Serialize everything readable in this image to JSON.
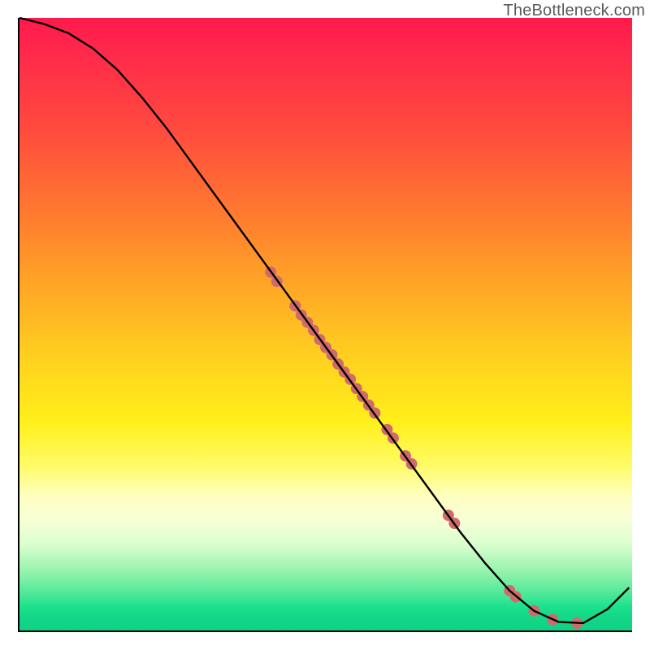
{
  "watermark": "TheBottleneck.com",
  "chart_data": {
    "type": "line",
    "title": "",
    "xlabel": "",
    "ylabel": "",
    "xlim": [
      0,
      100
    ],
    "ylim": [
      0,
      100
    ],
    "grid": false,
    "legend": false,
    "series": [
      {
        "name": "bottleneck-curve",
        "x": [
          0,
          4,
          8,
          12,
          16,
          20,
          24,
          28,
          32,
          36,
          40,
          44,
          48,
          52,
          56,
          60,
          64,
          68,
          72,
          76,
          80,
          84,
          88,
          92,
          96,
          99.5
        ],
        "y": [
          100,
          99,
          97.5,
          95,
          91.5,
          87,
          82,
          76.5,
          71,
          65.5,
          60,
          54.5,
          49,
          43.5,
          38,
          32.5,
          27,
          21.5,
          16,
          11,
          6.5,
          3.2,
          1.4,
          1.2,
          3.5,
          7
        ],
        "color": "#000000",
        "width": 2.4
      }
    ],
    "scatter_points": {
      "name": "highlighted-points",
      "color": "#d16a6a",
      "radius": 7,
      "points": [
        {
          "x": 41,
          "y": 58.5
        },
        {
          "x": 42,
          "y": 57
        },
        {
          "x": 45,
          "y": 53
        },
        {
          "x": 46,
          "y": 51.5
        },
        {
          "x": 47,
          "y": 50.3
        },
        {
          "x": 48,
          "y": 49
        },
        {
          "x": 49,
          "y": 47.5
        },
        {
          "x": 50,
          "y": 46.2
        },
        {
          "x": 51,
          "y": 45
        },
        {
          "x": 52,
          "y": 43.5
        },
        {
          "x": 53,
          "y": 42.2
        },
        {
          "x": 54,
          "y": 41
        },
        {
          "x": 55,
          "y": 39.5
        },
        {
          "x": 56,
          "y": 38.2
        },
        {
          "x": 57,
          "y": 36.8
        },
        {
          "x": 58,
          "y": 35.5
        },
        {
          "x": 60,
          "y": 32.8
        },
        {
          "x": 61,
          "y": 31.4
        },
        {
          "x": 63,
          "y": 28.5
        },
        {
          "x": 64,
          "y": 27.2
        },
        {
          "x": 70,
          "y": 18.8
        },
        {
          "x": 71,
          "y": 17.5
        },
        {
          "x": 80,
          "y": 6.5
        },
        {
          "x": 81,
          "y": 5.5
        },
        {
          "x": 84,
          "y": 3.2
        },
        {
          "x": 87,
          "y": 1.8
        },
        {
          "x": 91,
          "y": 1.2
        }
      ]
    }
  }
}
